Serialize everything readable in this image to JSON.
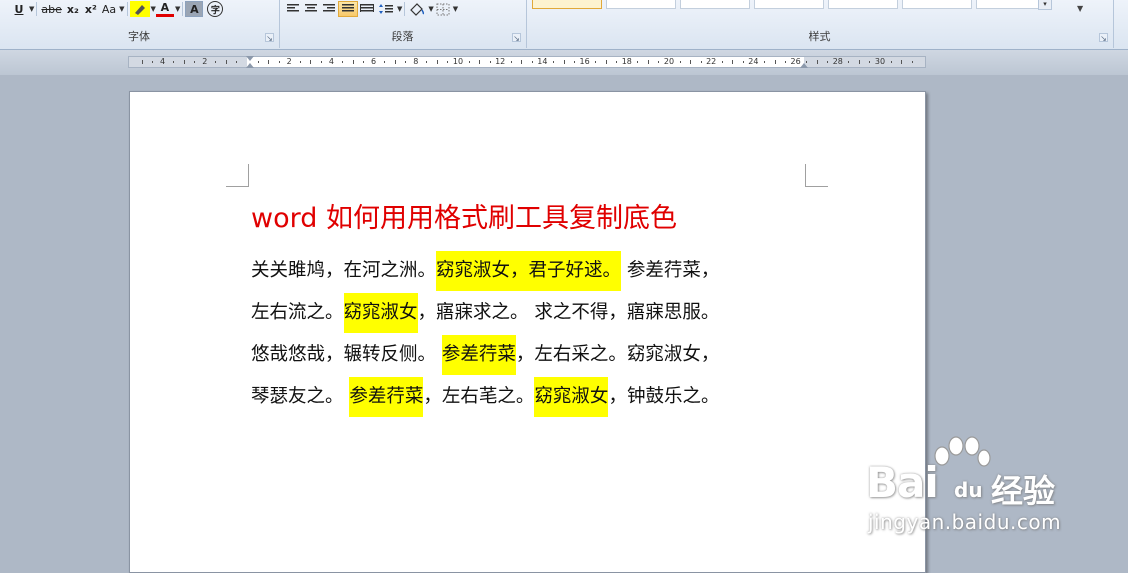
{
  "ribbon": {
    "font_group": {
      "label": "字体",
      "underline_label": "U",
      "strike_label": "abe",
      "subscript_label": "x₂",
      "superscript_label": "x²",
      "change_case_label": "Aa",
      "font_color_label": "A",
      "char_shading_label": "A",
      "enclose_label": "字"
    },
    "paragraph_group": {
      "label": "段落"
    },
    "styles_group": {
      "label": "样式"
    }
  },
  "ruler": {
    "labels": [
      "4",
      "2",
      "2",
      "4",
      "6",
      "8",
      "10",
      "12",
      "14",
      "16",
      "18",
      "20",
      "22",
      "24",
      "26",
      "28",
      "30"
    ]
  },
  "document": {
    "title": "word 如何用用格式刷工具复制底色",
    "lines": [
      [
        {
          "text": "关关雎鸠，在河之洲。",
          "hl": false
        },
        {
          "text": "窈窕淑女，君子好逑。",
          "hl": true
        },
        {
          "text": " 参差荇菜，",
          "hl": false
        }
      ],
      [
        {
          "text": "左右流之。",
          "hl": false
        },
        {
          "text": "窈窕淑女",
          "hl": true
        },
        {
          "text": "，寤寐求之。 求之不得，寤寐思服。",
          "hl": false
        }
      ],
      [
        {
          "text": "悠哉悠哉，辗转反侧。 ",
          "hl": false
        },
        {
          "text": "参差荇菜",
          "hl": true
        },
        {
          "text": "，左右采之。窈窕淑女，",
          "hl": false
        }
      ],
      [
        {
          "text": "琴瑟友之。 ",
          "hl": false
        },
        {
          "text": "参差荇菜",
          "hl": true
        },
        {
          "text": "，左右芼之。",
          "hl": false
        },
        {
          "text": "窈窕淑女",
          "hl": true
        },
        {
          "text": "，钟鼓乐之。",
          "hl": false
        }
      ]
    ]
  },
  "watermark": {
    "brand": "Bai",
    "brand_du": "du",
    "brand_cn": "经验",
    "url": "jingyan.baidu.com"
  },
  "colors": {
    "title_red": "#e00000",
    "highlight_yellow": "#ffff00",
    "ribbon_bg": "#dbe5f1",
    "workspace_bg": "#aeb8c6"
  }
}
